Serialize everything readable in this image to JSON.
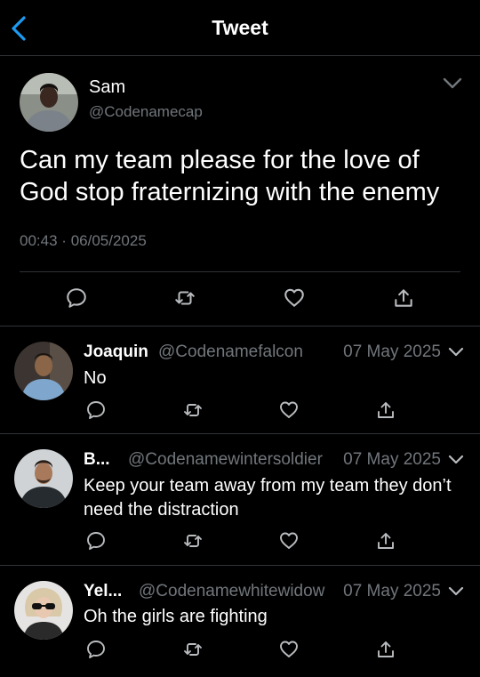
{
  "header": {
    "title": "Tweet"
  },
  "tweet": {
    "author_name": "Sam",
    "author_handle": "@Codenamecap",
    "text": "Can my team please for the love of God stop fraternizing with the enemy",
    "time": "00:43",
    "separator": "·",
    "date": "06/05/2025"
  },
  "replies": [
    {
      "name": "Joaquin",
      "handle": "@Codenamefalcon",
      "date": "07 May 2025",
      "text": "No"
    },
    {
      "name": "B...",
      "handle": "@Codenamewintersoldier",
      "date": "07 May 2025",
      "text": "Keep your team away from my team they don’t need the distraction"
    },
    {
      "name": "Yel...",
      "handle": "@Codenamewhitewidow",
      "date": "07 May 2025",
      "text": "Oh the girls are fighting"
    }
  ],
  "icons": {
    "back": "chevron-left-icon",
    "menu": "chevron-down-icon",
    "reply": "comment-icon",
    "retweet": "retweet-icon",
    "like": "heart-icon",
    "share": "share-icon"
  },
  "colors": {
    "accent": "#1d9bf0",
    "background": "#000000",
    "secondary_text": "#71767b",
    "icon": "#b9bcbf"
  }
}
